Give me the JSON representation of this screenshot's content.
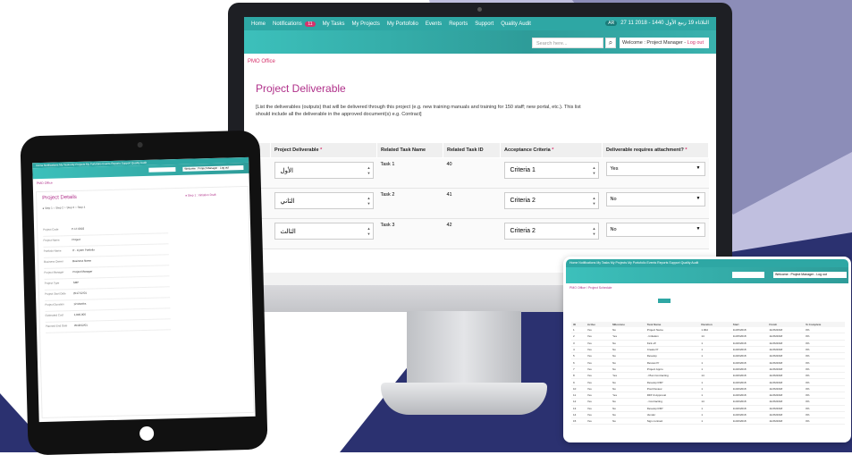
{
  "colors": {
    "teal": "#2ea7a4",
    "magenta": "#b0308a",
    "pink": "#d6336c",
    "navy": "#2b3170",
    "lavender": "#b5b4d9"
  },
  "main": {
    "nav": {
      "home": "Home",
      "notifications": "Notifications",
      "notif_count": "11",
      "my_tasks": "My Tasks",
      "my_projects": "My Projects",
      "my_portfolio": "My Portofolio",
      "events": "Events",
      "reports": "Reports",
      "support": "Support",
      "quality_audit": "Quality Audit",
      "lang": "AR",
      "date": "الثلاثاء 19 ربيع الأول 1440 - 2018 11 27"
    },
    "search_placeholder": "Search here...",
    "welcome_prefix": "Welcome : Project Manager - ",
    "logout": "Log out",
    "breadcrumb": "PMO Office",
    "title": "Project Deliverable",
    "description": "[List the deliverables (outputs) that will be delivered through this project (e.g. new training manuals and training for 150 staff; new portal, etc.). This list should include all the deliverable in the approved document(s) e.g. Contract]",
    "headers": {
      "num": "#",
      "deliverable": "Project Deliverable",
      "task_name": "Related Task Name",
      "task_number": "Related Task ID",
      "criteria": "Acceptance Criteria",
      "attachment": "Deliverable requires attachment?"
    },
    "required_mark": "*",
    "rows": [
      {
        "deliverable": "الأول",
        "task": "Task 1",
        "id": "40",
        "criteria": "Criteria 1",
        "attachment": "Yes"
      },
      {
        "deliverable": "الثاني",
        "task": "Task 2",
        "id": "41",
        "criteria": "Criteria 2",
        "attachment": "No"
      },
      {
        "deliverable": "الثالث",
        "task": "Task 3",
        "id": "42",
        "criteria": "Criteria 2",
        "attachment": "No"
      }
    ]
  },
  "tablet": {
    "nav": "Home  Notifications  My Tasks  My Projects  My Portofolio  Events  Reports  Support  Quality Audit",
    "welcome": "Welcome : Project Manager - Log out",
    "breadcrumb": "PMO Office",
    "title": "Project Details",
    "steps": "● Step 1   ○ Step 2   ○ Step 3   ○ Step 4",
    "side": "● Step 1 : Initiation Draft",
    "fields": [
      {
        "label": "Project Code",
        "value": "P-17-0003"
      },
      {
        "label": "Project Name",
        "value": "Project"
      },
      {
        "label": "Portfolio Name",
        "value": "IT - Cyber Portfolio"
      },
      {
        "label": "Business Owner",
        "value": "Business Name"
      },
      {
        "label": "Project Manager",
        "value": "Project Manager"
      },
      {
        "label": "Project Type",
        "value": "SMP"
      },
      {
        "label": "Project Start Date",
        "value": "2017/12/01"
      },
      {
        "label": "Project Duration",
        "value": "12 Months"
      },
      {
        "label": "Estimated Cost",
        "value": "1,000,000"
      },
      {
        "label": "Planned End Date",
        "value": "2018/12/01"
      }
    ]
  },
  "laptop": {
    "nav": "Home  Notifications  My Tasks  My Projects  My Portofolio  Events  Reports  Support  Quality Audit",
    "welcome": "Welcome : Project Manager - Log out",
    "breadcrumb": "PMO Office  /  Project Schedule",
    "headers": [
      "Milestone",
      "ID",
      "Active",
      "Milestone",
      "Dep.",
      "Mode",
      "Task Name",
      "Duration",
      "Start",
      "Finish",
      "% Complete"
    ],
    "rows": [
      [
        "1",
        "Yes",
        "No",
        "Project Name",
        "1.00d",
        "11/25/2018",
        "11/26/2018",
        "0%"
      ],
      [
        "2",
        "Yes",
        "Yes",
        "- Initiation",
        "14",
        "11/25/2018",
        "11/26/2018",
        "0%"
      ],
      [
        "3",
        "Yes",
        "No",
        "Kick off",
        "1",
        "11/26/2018",
        "11/26/2018",
        "0%"
      ],
      [
        "4",
        "Yes",
        "No",
        "Create Pr",
        "1",
        "11/26/2018",
        "11/26/2018",
        "0%"
      ],
      [
        "5",
        "Yes",
        "No",
        "Develop",
        "1",
        "11/26/2018",
        "11/26/2018",
        "0%"
      ],
      [
        "6",
        "Yes",
        "No",
        "Review Pr",
        "1",
        "11/26/2018",
        "11/26/2018",
        "0%"
      ],
      [
        "7",
        "Yes",
        "No",
        "Project Appro",
        "1",
        "11/26/2018",
        "11/26/2018",
        "0%"
      ],
      [
        "8",
        "Yes",
        "Yes",
        "- Plan Contracting",
        "14",
        "11/26/2018",
        "11/26/2018",
        "0%"
      ],
      [
        "9",
        "Yes",
        "No",
        "Develop RFP",
        "1",
        "11/26/2018",
        "11/26/2018",
        "0%"
      ],
      [
        "10",
        "Yes",
        "No",
        "Post Review",
        "1",
        "11/26/2018",
        "11/26/2018",
        "0%"
      ],
      [
        "11",
        "Yes",
        "Yes",
        "RFP & Approval",
        "1",
        "11/26/2018",
        "11/26/2018",
        "0%"
      ],
      [
        "12",
        "Yes",
        "No",
        "- Contracting",
        "14",
        "11/26/2018",
        "11/26/2018",
        "0%"
      ],
      [
        "13",
        "Yes",
        "No",
        "Develop RFP",
        "1",
        "11/26/2018",
        "11/26/2018",
        "0%"
      ],
      [
        "14",
        "Yes",
        "No",
        "Vendor",
        "1",
        "11/26/2018",
        "11/26/2018",
        "0%"
      ],
      [
        "15",
        "Yes",
        "No",
        "Sign contract",
        "1",
        "11/26/2018",
        "11/26/2018",
        "0%"
      ]
    ]
  }
}
